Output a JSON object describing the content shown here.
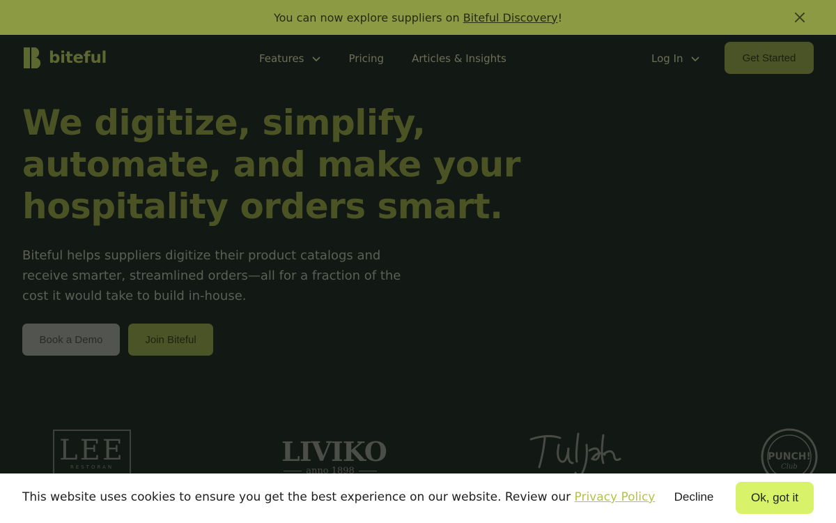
{
  "announcement": {
    "text_before": "You can now explore suppliers on ",
    "link": "Biteful Discovery",
    "text_after": "!",
    "close_icon": "close-icon"
  },
  "header": {
    "brand": "biteful",
    "nav": [
      {
        "label": "Features",
        "has_dropdown": true
      },
      {
        "label": "Pricing",
        "has_dropdown": false
      },
      {
        "label": "Articles & Insights",
        "has_dropdown": false
      }
    ],
    "login_label": "Log In",
    "cta_label": "Get Started"
  },
  "hero": {
    "title_lines": [
      "We digitize, simplify,",
      "automate, and make your",
      "hospitality orders smart."
    ],
    "subtitle_lines": [
      "Biteful helps suppliers digitize their product catalogs and",
      "receive smarter, streamlined orders—all for a fraction of the",
      "cost it would take to build in-house."
    ],
    "demo_label": "Book a Demo",
    "join_label": "Join Biteful"
  },
  "logos": {
    "lee": {
      "main": "LEE",
      "sub": "RESTORAN"
    },
    "liviko": {
      "main": "LIVIKO",
      "sub": "anno 1898"
    },
    "tuljak": {
      "main": "Tuljak"
    },
    "punch": {
      "main": "PUNCH!",
      "sub": "Club"
    }
  },
  "cookie": {
    "message": "This website uses cookies to ensure you get the best experience on our website. Review our ",
    "policy_link": "Privacy Policy",
    "decline_label": "Decline",
    "accept_label": "Ok, got it"
  },
  "colors": {
    "announcement_bg": "#8d9a44",
    "accent": "#d8f36a",
    "link_accent": "#b4c24a",
    "page_bg": "#121813"
  }
}
